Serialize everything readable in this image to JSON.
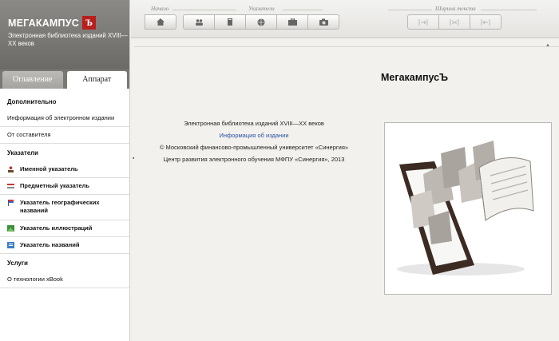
{
  "brand": {
    "title": "МЕГАКАМПУС",
    "logo_glyph": "Ъ",
    "subtitle": "Электронная библиотека изданий XVIII—XX веков",
    "logo_color": "#b81f1c"
  },
  "tabs": [
    {
      "label": "Оглавление",
      "active": false
    },
    {
      "label": "Аппарат",
      "active": true
    }
  ],
  "menu": {
    "section_additional": "Дополнительно",
    "item_info": "Информация об электронном издании",
    "item_compiler": "От составителя",
    "section_indexes": "Указатели",
    "item_names": "Именной указатель",
    "item_subject": "Предметный указатель",
    "item_geo": "Указатель географических названий",
    "item_illustrations": "Указатель иллюстраций",
    "item_titles": "Указатель названий",
    "section_services": "Услуги",
    "item_xbook": "О технологии xBook"
  },
  "toolbar": {
    "group_start": "Начало",
    "group_indexes": "Указатели",
    "group_width": "Ширина текста",
    "icons": [
      "home-icon",
      "people-icon",
      "book-icon",
      "globe-icon",
      "briefcase-icon",
      "camera-icon"
    ],
    "width_icons": [
      "narrow-icon",
      "medium-icon",
      "wide-icon"
    ]
  },
  "content": {
    "book_title": "МегакампусЪ",
    "info_line1": "Электронная библиотека изданий XVIII—XX веков",
    "info_link": "Информация об издании",
    "info_line3": "© Московский финансово-промышленный университет «Синергия»",
    "info_line4": "Центр развития электронного обучения МФПУ «Синергия», 2013"
  }
}
